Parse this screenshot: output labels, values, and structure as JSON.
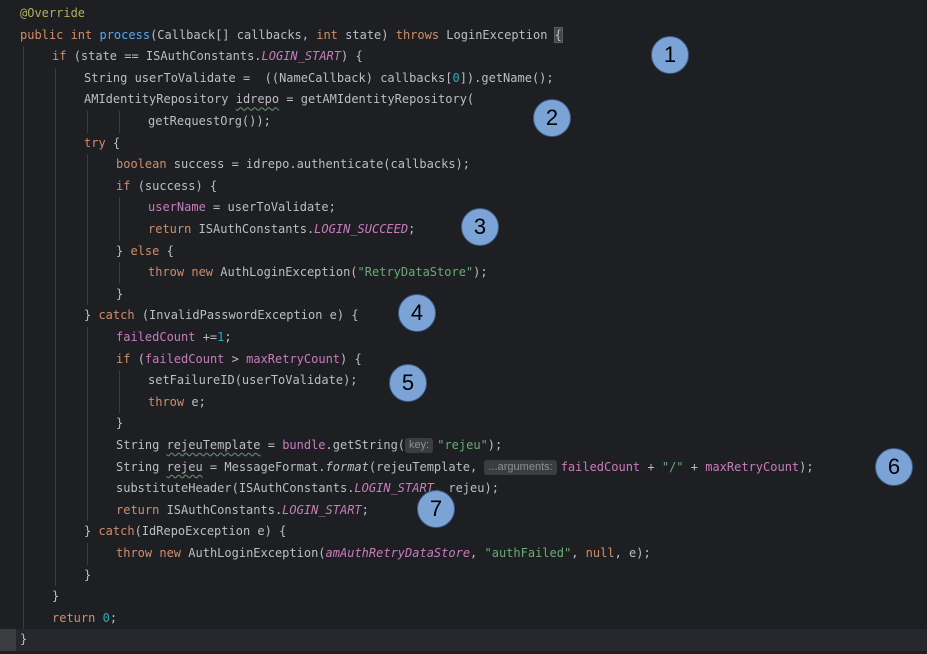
{
  "code_lines": [
    {
      "indent": 0,
      "tokens": [
        {
          "t": "@Override",
          "c": "ann"
        }
      ]
    },
    {
      "indent": 0,
      "tokens": [
        {
          "t": "public ",
          "c": "kw"
        },
        {
          "t": "int ",
          "c": "kw"
        },
        {
          "t": "process",
          "c": "fn"
        },
        {
          "t": "(Callback[] callbacks, "
        },
        {
          "t": "int ",
          "c": "kw"
        },
        {
          "t": "state) "
        },
        {
          "t": "throws ",
          "c": "kw"
        },
        {
          "t": "LoginException "
        },
        {
          "t": "{",
          "c": "bracket"
        }
      ]
    },
    {
      "indent": 1,
      "tokens": [
        {
          "t": "if ",
          "c": "kw"
        },
        {
          "t": "(state == ISAuthConstants."
        },
        {
          "t": "LOGIN_START",
          "c": "const"
        },
        {
          "t": ") {"
        }
      ]
    },
    {
      "indent": 2,
      "tokens": [
        {
          "t": "String userToValidate =  ((NameCallback) callbacks["
        },
        {
          "t": "0",
          "c": "num"
        },
        {
          "t": "]).getName();"
        }
      ]
    },
    {
      "indent": 2,
      "tokens": [
        {
          "t": "AMIdentityRepository "
        },
        {
          "t": "idrepo",
          "c": "under"
        },
        {
          "t": " = getAMIdentityRepository("
        }
      ]
    },
    {
      "indent": 4,
      "tokens": [
        {
          "t": "getRequestOrg());"
        }
      ]
    },
    {
      "indent": 2,
      "tokens": [
        {
          "t": "try ",
          "c": "kw"
        },
        {
          "t": "{"
        }
      ]
    },
    {
      "indent": 3,
      "tokens": [
        {
          "t": "boolean ",
          "c": "kw"
        },
        {
          "t": "success = idrepo.authenticate(callbacks);"
        }
      ]
    },
    {
      "indent": 3,
      "tokens": [
        {
          "t": "if ",
          "c": "kw"
        },
        {
          "t": "(success) {"
        }
      ]
    },
    {
      "indent": 4,
      "tokens": [
        {
          "t": "userName",
          "c": "field"
        },
        {
          "t": " = userToValidate;"
        }
      ]
    },
    {
      "indent": 4,
      "tokens": [
        {
          "t": "return ",
          "c": "kw"
        },
        {
          "t": "ISAuthConstants."
        },
        {
          "t": "LOGIN_SUCCEED",
          "c": "const"
        },
        {
          "t": ";"
        }
      ]
    },
    {
      "indent": 3,
      "tokens": [
        {
          "t": "} "
        },
        {
          "t": "else ",
          "c": "kw"
        },
        {
          "t": "{"
        }
      ]
    },
    {
      "indent": 4,
      "tokens": [
        {
          "t": "throw ",
          "c": "kw"
        },
        {
          "t": "new ",
          "c": "kw"
        },
        {
          "t": "AuthLoginException("
        },
        {
          "t": "\"RetryDataStore\"",
          "c": "str"
        },
        {
          "t": ");"
        }
      ]
    },
    {
      "indent": 3,
      "tokens": [
        {
          "t": "}"
        }
      ]
    },
    {
      "indent": 2,
      "tokens": [
        {
          "t": "} "
        },
        {
          "t": "catch ",
          "c": "kw"
        },
        {
          "t": "(InvalidPasswordException e) {"
        }
      ]
    },
    {
      "indent": 3,
      "tokens": [
        {
          "t": "failedCount",
          "c": "field"
        },
        {
          "t": " +="
        },
        {
          "t": "1",
          "c": "num"
        },
        {
          "t": ";"
        }
      ]
    },
    {
      "indent": 3,
      "tokens": [
        {
          "t": "if ",
          "c": "kw"
        },
        {
          "t": "("
        },
        {
          "t": "failedCount",
          "c": "field"
        },
        {
          "t": " > "
        },
        {
          "t": "maxRetryCount",
          "c": "field"
        },
        {
          "t": ") {"
        }
      ]
    },
    {
      "indent": 4,
      "tokens": [
        {
          "t": "setFailureID(userToValidate);"
        }
      ]
    },
    {
      "indent": 4,
      "tokens": [
        {
          "t": "throw ",
          "c": "kw"
        },
        {
          "t": "e;"
        }
      ]
    },
    {
      "indent": 3,
      "tokens": [
        {
          "t": "}"
        }
      ]
    },
    {
      "indent": 3,
      "tokens": [
        {
          "t": "String "
        },
        {
          "t": "rejeuTemplate",
          "c": "under"
        },
        {
          "t": " = "
        },
        {
          "t": "bundle",
          "c": "field"
        },
        {
          "t": ".getString("
        },
        {
          "t": "key:",
          "c": "hint"
        },
        {
          "t": "\"rejeu\"",
          "c": "str"
        },
        {
          "t": ");"
        }
      ]
    },
    {
      "indent": 3,
      "tokens": [
        {
          "t": "String "
        },
        {
          "t": "rejeu",
          "c": "under"
        },
        {
          "t": " = MessageFormat."
        },
        {
          "t": "format",
          "c": "ital"
        },
        {
          "t": "(rejeuTemplate, "
        },
        {
          "t": "...arguments:",
          "c": "hint"
        },
        {
          "t": "failedCount",
          "c": "field"
        },
        {
          "t": " + "
        },
        {
          "t": "\"/\"",
          "c": "str"
        },
        {
          "t": " + "
        },
        {
          "t": "maxRetryCount",
          "c": "field"
        },
        {
          "t": ");"
        }
      ]
    },
    {
      "indent": 3,
      "tokens": [
        {
          "t": "substituteHeader(ISAuthConstants."
        },
        {
          "t": "LOGIN_START",
          "c": "const"
        },
        {
          "t": ", rejeu);"
        }
      ]
    },
    {
      "indent": 3,
      "tokens": [
        {
          "t": "return ",
          "c": "kw"
        },
        {
          "t": "ISAuthConstants."
        },
        {
          "t": "LOGIN_START",
          "c": "const"
        },
        {
          "t": ";"
        }
      ]
    },
    {
      "indent": 2,
      "tokens": [
        {
          "t": "} "
        },
        {
          "t": "catch",
          "c": "kw"
        },
        {
          "t": "(IdRepoException e) {"
        }
      ]
    },
    {
      "indent": 3,
      "tokens": [
        {
          "t": "throw ",
          "c": "kw"
        },
        {
          "t": "new ",
          "c": "kw"
        },
        {
          "t": "AuthLoginException("
        },
        {
          "t": "amAuthRetryDataStore",
          "c": "const"
        },
        {
          "t": ", "
        },
        {
          "t": "\"authFailed\"",
          "c": "str"
        },
        {
          "t": ", "
        },
        {
          "t": "null",
          "c": "kw"
        },
        {
          "t": ", e);"
        }
      ]
    },
    {
      "indent": 2,
      "tokens": [
        {
          "t": "}"
        }
      ]
    },
    {
      "indent": 1,
      "tokens": [
        {
          "t": "}"
        }
      ]
    },
    {
      "indent": 1,
      "tokens": [
        {
          "t": "return ",
          "c": "kw"
        },
        {
          "t": "0",
          "c": "num"
        },
        {
          "t": ";"
        }
      ]
    },
    {
      "indent": 0,
      "tokens": [
        {
          "t": "}"
        }
      ],
      "caret": true
    }
  ],
  "markers": {
    "m1": "1",
    "m2": "2",
    "m3": "3",
    "m4": "4",
    "m5": "5",
    "m6": "6",
    "m7": "7"
  },
  "colors": {
    "background": "#1e1f22",
    "keyword": "#cf8e6d",
    "function": "#56a8f5",
    "string": "#6aab73",
    "number": "#2aacb8",
    "field": "#c77dbb",
    "annotation": "#b3ae60",
    "marker": "#7ca3d6"
  }
}
